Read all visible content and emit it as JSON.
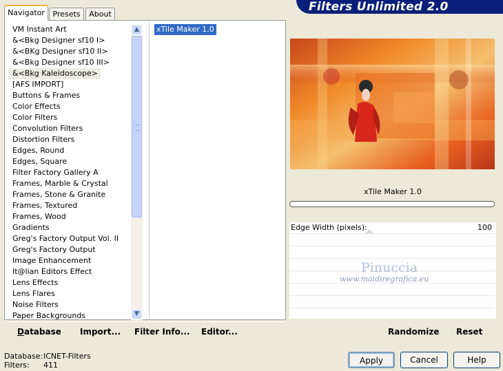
{
  "app": {
    "title": "Filters Unlimited 2.0"
  },
  "tabs": [
    {
      "label": "Navigator",
      "active": true
    },
    {
      "label": "Presets",
      "active": false
    },
    {
      "label": "About",
      "active": false
    }
  ],
  "categories": [
    "VM Instant Art",
    "&<Bkg Designer sf10 I>",
    "&<BKg Designer sf10 II>",
    "&<Bkg Designer sf10 III>",
    "&<Bkg Kaleidoscope>",
    "[AFS IMPORT]",
    "Buttons & Frames",
    "Color Effects",
    "Color Filters",
    "Convolution Filters",
    "Distortion Filters",
    "Edges, Round",
    "Edges, Square",
    "Filter Factory Gallery A",
    "Frames, Marble & Crystal",
    "Frames, Stone & Granite",
    "Frames, Textured",
    "Frames, Wood",
    "Gradients",
    "Greg's Factory Output Vol. II",
    "Greg's Factory Output",
    "Image Enhancement",
    "It@lian Editors Effect",
    "Lens Effects",
    "Lens Flares",
    "Noise Filters",
    "Paper Backgrounds"
  ],
  "selected_category": "&<Bkg Kaleidoscope>",
  "filters": [
    "xTile Maker 1.0"
  ],
  "toolbar": {
    "database": "Database",
    "import": "Import...",
    "filter_info": "Filter Info...",
    "editor": "Editor...",
    "randomize": "Randomize",
    "reset": "Reset"
  },
  "preview": {
    "filter_name": "xTile Maker 1.0"
  },
  "params": {
    "edge_width_label": "Edge Width (pixels):",
    "edge_width_value": "100"
  },
  "watermark": {
    "name": "Pinuccia",
    "site": "www.maidiregrafica.eu"
  },
  "status": {
    "database_label": "Database:",
    "database_value": "ICNET-Filters",
    "filters_label": "Filters:",
    "filters_value": "411"
  },
  "buttons": {
    "apply": "Apply",
    "cancel": "Cancel",
    "help": "Help"
  },
  "colors": {
    "banner": "#0a1f7a",
    "selection": "#316ac5",
    "active_tab_accent": "#f2b43c"
  }
}
